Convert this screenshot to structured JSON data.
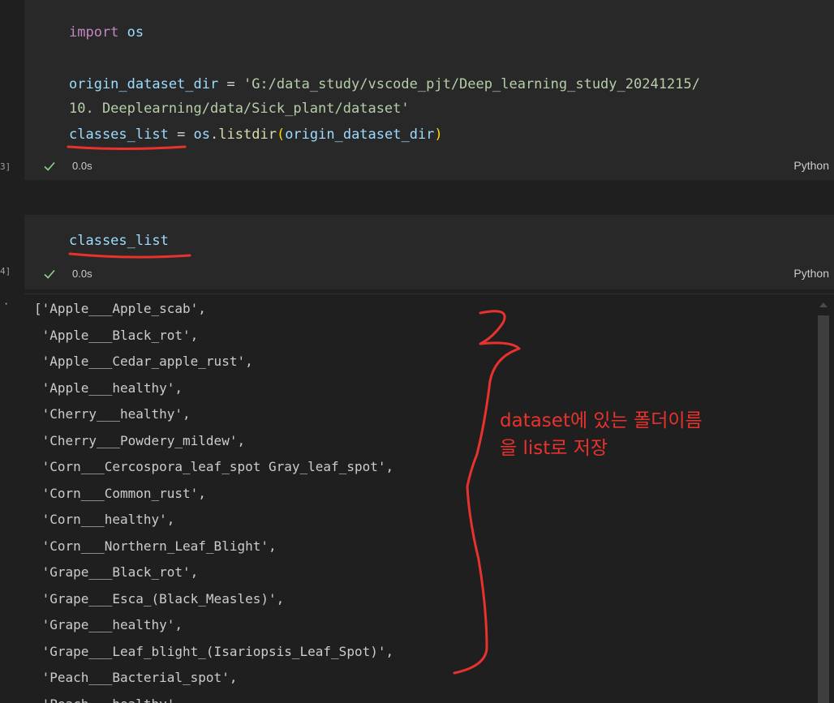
{
  "cells": [
    {
      "exec_count": "3]",
      "lines": [
        [
          {
            "t": "import",
            "c": "kw"
          },
          {
            "t": " os",
            "c": "var"
          }
        ],
        [],
        [
          {
            "t": "origin_dataset_dir",
            "c": "var"
          },
          {
            "t": " = ",
            "c": "op"
          },
          {
            "t": "'G:/data_study/vscode_pjt/Deep_learning_study_20241215/",
            "c": "str-green"
          }
        ],
        [
          {
            "t": "10. Deeplearning/data/Sick_plant/dataset'",
            "c": "str-green"
          }
        ],
        [
          {
            "t": "classes_list",
            "c": "var"
          },
          {
            "t": " = ",
            "c": "op"
          },
          {
            "t": "os",
            "c": "var"
          },
          {
            "t": ".",
            "c": "op"
          },
          {
            "t": "listdir",
            "c": "fn"
          },
          {
            "t": "(",
            "c": "paren"
          },
          {
            "t": "origin_dataset_dir",
            "c": "var"
          },
          {
            "t": ")",
            "c": "paren"
          }
        ]
      ],
      "status": {
        "time": "0.0s",
        "language": "Python"
      }
    },
    {
      "exec_count": "4]",
      "lines": [
        [
          {
            "t": "classes_list",
            "c": "var"
          }
        ]
      ],
      "status": {
        "time": "0.0s",
        "language": "Python"
      }
    }
  ],
  "output": {
    "marker": "·",
    "lines": [
      "['Apple___Apple_scab',",
      " 'Apple___Black_rot',",
      " 'Apple___Cedar_apple_rust',",
      " 'Apple___healthy',",
      " 'Cherry___healthy',",
      " 'Cherry___Powdery_mildew',",
      " 'Corn___Cercospora_leaf_spot Gray_leaf_spot',",
      " 'Corn___Common_rust',",
      " 'Corn___healthy',",
      " 'Corn___Northern_Leaf_Blight',",
      " 'Grape___Black_rot',",
      " 'Grape___Esca_(Black_Measles)',",
      " 'Grape___healthy',",
      " 'Grape___Leaf_blight_(Isariopsis_Leaf_Spot)',",
      " 'Peach___Bacterial_spot',",
      " 'Peach___healthy',"
    ]
  },
  "annotation": {
    "line1": "dataset에 있는 폴더이름",
    "line2": "을 list로 저장"
  },
  "colors": {
    "annotation_red": "#e8322e",
    "cell_bg": "#282828",
    "page_bg": "#1f1f1f",
    "success_green": "#89d185"
  },
  "icons": {
    "status": "check-icon"
  }
}
